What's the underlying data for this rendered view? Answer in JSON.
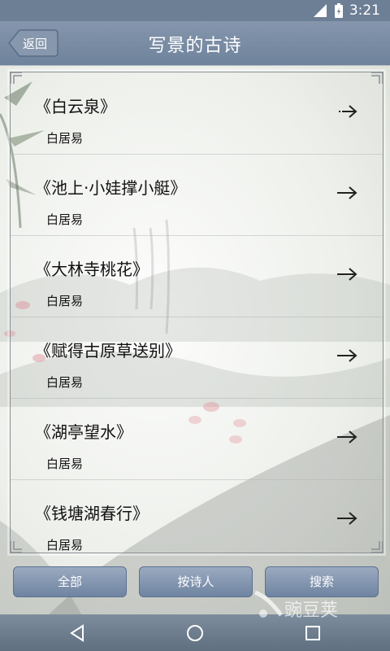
{
  "status_bar": {
    "time": "3:21"
  },
  "header": {
    "back_label": "返回",
    "title": "写景的古诗"
  },
  "poems": [
    {
      "title": "《白云泉》",
      "poet": "白居易"
    },
    {
      "title": "《池上·小娃撑小艇》",
      "poet": "白居易"
    },
    {
      "title": "《大林寺桃花》",
      "poet": "白居易"
    },
    {
      "title": "《赋得古原草送别》",
      "poet": "白居易"
    },
    {
      "title": "《湖亭望水》",
      "poet": "白居易"
    },
    {
      "title": "《钱塘湖春行》",
      "poet": "白居易"
    }
  ],
  "tabs": {
    "all": "全部",
    "by_poet": "按诗人",
    "search": "搜索"
  },
  "watermark": "豌豆荚",
  "colors": {
    "title_bar": "#7386a0",
    "button": "#8093ae",
    "nav_bar": "#6b7b8c"
  }
}
